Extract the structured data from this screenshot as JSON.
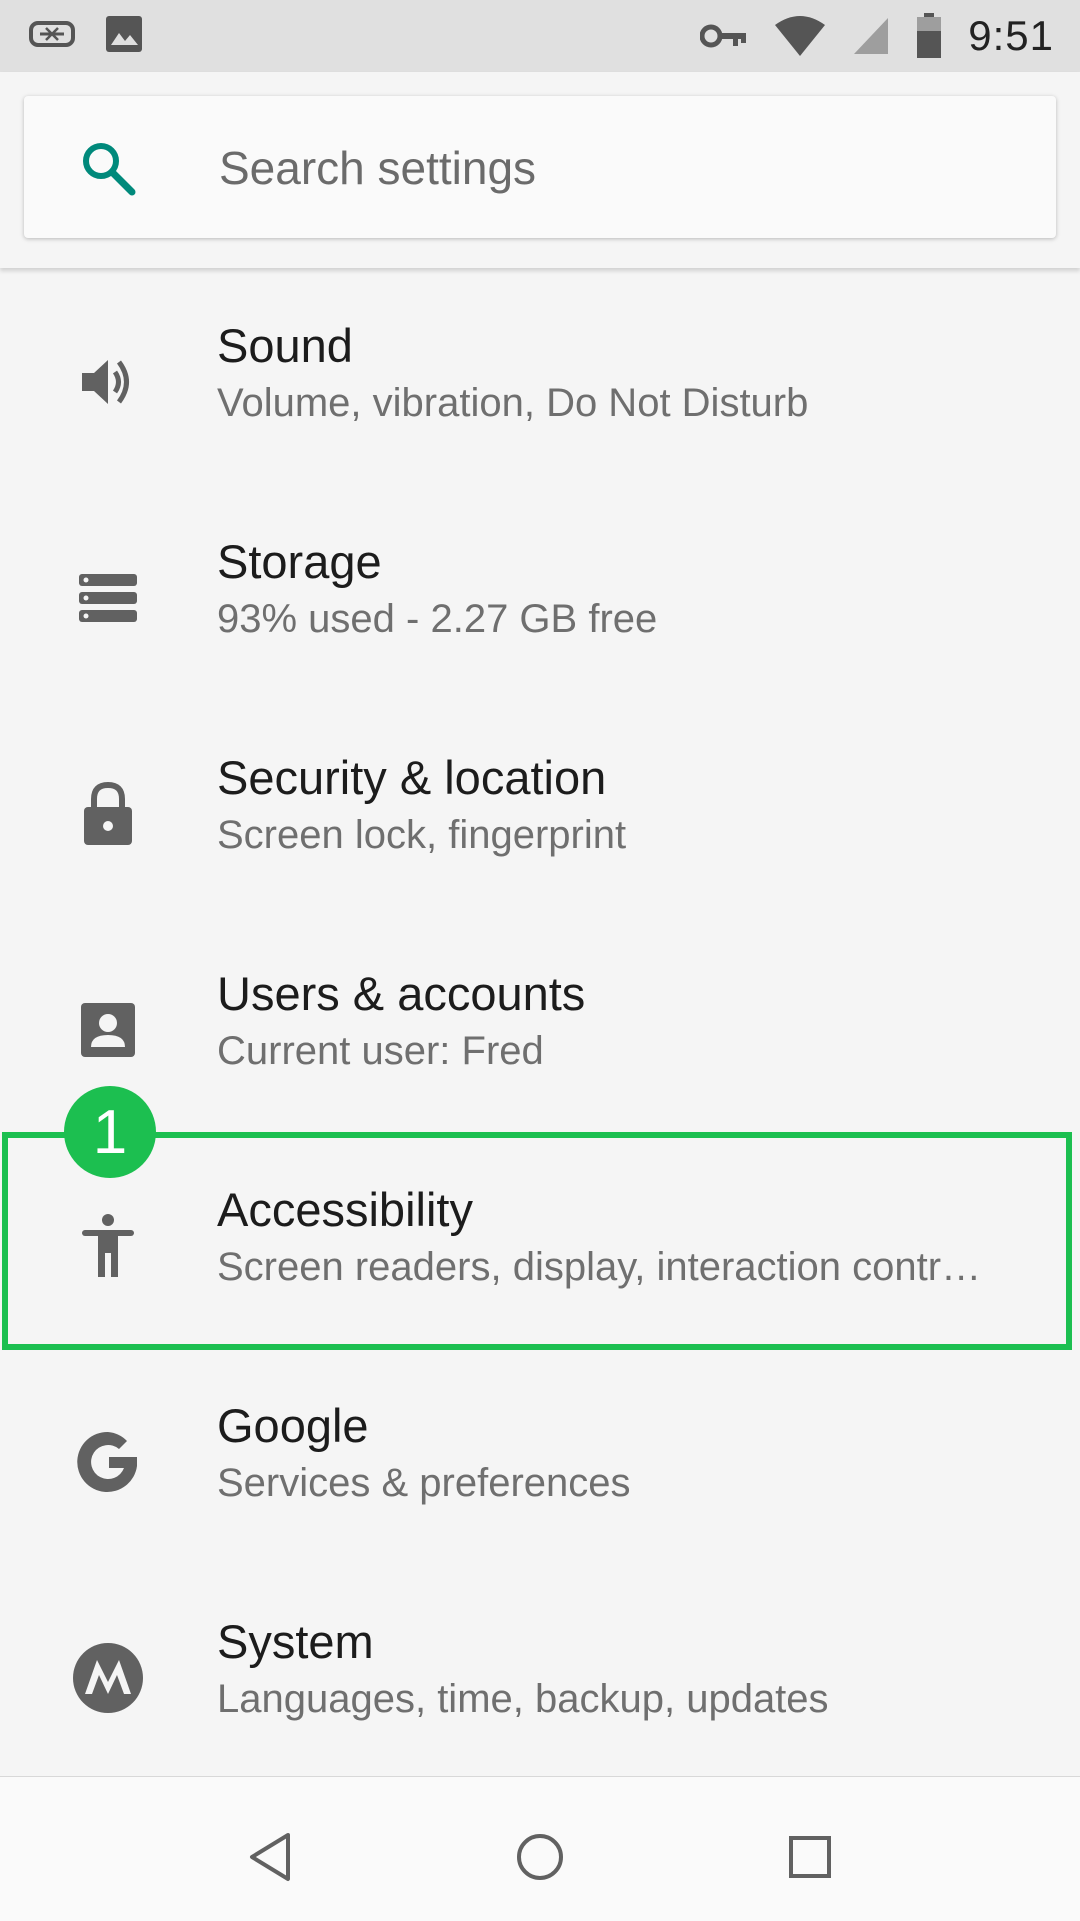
{
  "status_bar": {
    "time": "9:51",
    "icons": [
      "vr-headset-icon",
      "image-icon",
      "vpn-key-icon",
      "wifi-icon",
      "signal-icon",
      "battery-icon"
    ]
  },
  "search": {
    "placeholder": "Search settings"
  },
  "items": [
    {
      "title": "Sound",
      "subtitle": "Volume, vibration, Do Not Disturb",
      "icon": "volume-icon"
    },
    {
      "title": "Storage",
      "subtitle": "93% used - 2.27 GB free",
      "icon": "storage-icon"
    },
    {
      "title": "Security & location",
      "subtitle": "Screen lock, fingerprint",
      "icon": "lock-icon"
    },
    {
      "title": "Users & accounts",
      "subtitle": "Current user: Fred",
      "icon": "account-icon"
    },
    {
      "title": "Accessibility",
      "subtitle": "Screen readers, display, interaction contr…",
      "icon": "accessibility-icon"
    },
    {
      "title": "Google",
      "subtitle": "Services & preferences",
      "icon": "google-icon"
    },
    {
      "title": "System",
      "subtitle": "Languages, time, backup, updates",
      "icon": "motorola-icon"
    }
  ],
  "annotation": {
    "badge_label": "1",
    "color": "#1cbf50"
  },
  "navbar": {
    "buttons": [
      "back-icon",
      "home-icon",
      "recents-icon"
    ]
  },
  "colors": {
    "accent": "#00897b",
    "icon_gray": "#616161"
  }
}
